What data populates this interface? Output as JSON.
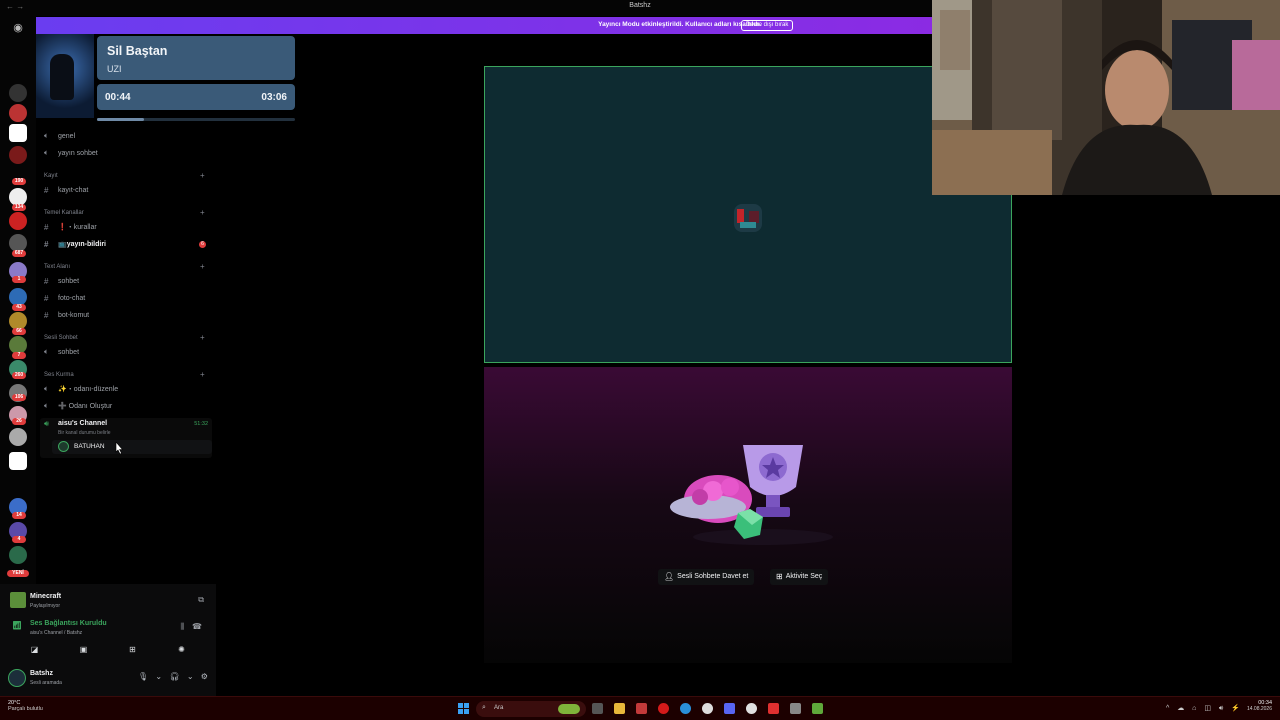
{
  "window": {
    "title": "Batshz"
  },
  "notice": {
    "text": "Yayıncı Modu etkinleştirildi. Kullanıcı adları kısaltıldı.",
    "button": "Devre dışı bırak"
  },
  "rail": {
    "badges": [
      "190",
      "134",
      "687",
      "1",
      "43",
      "66",
      "7",
      "260",
      "106",
      "26",
      "14",
      "4"
    ],
    "new_label": "YENİ"
  },
  "music": {
    "song": "Sil Baştan",
    "artist": "UZI",
    "current_time": "00:44",
    "total_time": "03:06",
    "progress": 0.237
  },
  "channels": {
    "items": [
      {
        "type": "voice",
        "label": "genel"
      },
      {
        "type": "voice",
        "label": "yayın sohbet"
      },
      {
        "type": "category",
        "label": "Kayıt"
      },
      {
        "type": "text",
        "label": "kayıt-chat"
      },
      {
        "type": "category",
        "label": "Temel Kanallar"
      },
      {
        "type": "text",
        "label": "❗・kurallar"
      },
      {
        "type": "text",
        "label": "📺yayın-bildiri",
        "unread": "6"
      },
      {
        "type": "category",
        "label": "Text Alanı"
      },
      {
        "type": "text",
        "label": "sohbet"
      },
      {
        "type": "text",
        "label": "foto-chat"
      },
      {
        "type": "text",
        "label": "bot-komut"
      },
      {
        "type": "category",
        "label": "Sesli Sohbet"
      },
      {
        "type": "voice",
        "label": "sohbet"
      },
      {
        "type": "category",
        "label": "Ses Kurma"
      },
      {
        "type": "voice",
        "label": "✨・odanı-düzenle"
      },
      {
        "type": "voice",
        "label": "➕ Odanı Oluştur"
      }
    ],
    "active_voice": {
      "name": "aisu's Channel",
      "status": "Bir kanal durumu belirle",
      "timer": "51:32",
      "member": "BATUHAN"
    }
  },
  "panel": {
    "game": {
      "name": "Minecraft",
      "status": "Paylaşılmıyor"
    },
    "voice": {
      "status": "Ses Bağlantısı Kuruldu",
      "channel": "aisu's Channel / Batshz"
    },
    "user": {
      "name": "Batshz",
      "status": "Sesli aramada"
    }
  },
  "stage": {
    "invite_button": "Sesli Sohbete Davet et",
    "activity_button": "Aktivite Seç"
  },
  "taskbar": {
    "weather_temp": "20°C",
    "weather_desc": "Parçalı bulutlu",
    "search_label": "Ara",
    "time": "00:34",
    "date": "14.08.2026"
  },
  "colors": {
    "accent": "#5865f2",
    "speaking": "#3ba55d",
    "notice": "#7b35ea",
    "taskbar": "#1c0000"
  }
}
